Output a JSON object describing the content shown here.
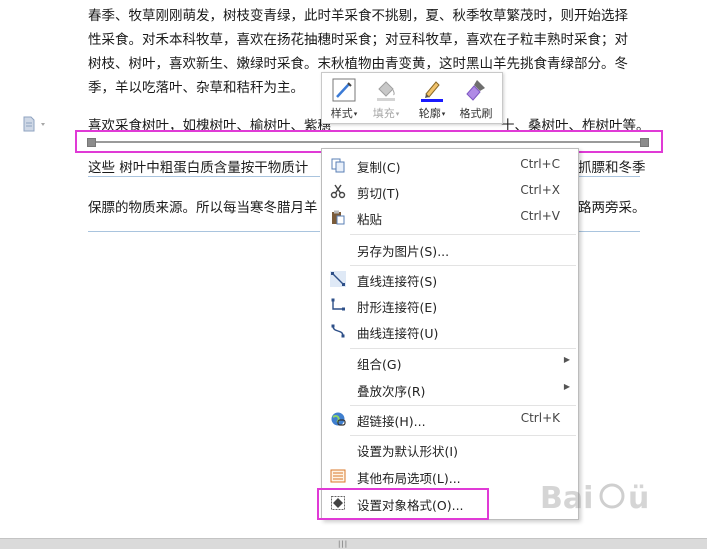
{
  "document": {
    "paragraph1": [
      "春季、牧草刚刚萌发，树枝变青绿，此时羊采食不挑剔，夏、秋季牧草繁茂时，则开始选择",
      "性采食。对禾本科牧草，喜欢在扬花抽穗时采食；对豆科牧草，喜欢在子粒丰熟时采食；对",
      "树枝、树叶，喜欢新生、嫩绿时采食。末秋植物由青变黄，这时黑山羊先挑食青绿部分。冬",
      "季，羊以吃落叶、杂草和秸秆为主。"
    ],
    "line_left": "喜欢采食树叶，如槐树叶、榆树叶、紫穗",
    "line_right": "十、桑树叶、柞树叶等。",
    "line2_left": "这些  树叶中粗蛋白质含量按干物质计",
    "line2_right": "抓膘和冬季",
    "line3_left": "保膘的物质来源。所以每当寒冬腊月羊",
    "line3_right": "路两旁采。"
  },
  "mini_toolbar": {
    "items": [
      {
        "label": "样式",
        "icon": "style-pen-icon",
        "enabled": true,
        "has_dropdown": true
      },
      {
        "label": "填充",
        "icon": "fill-bucket-icon",
        "enabled": false,
        "has_dropdown": true
      },
      {
        "label": "轮廓",
        "icon": "outline-pen-icon",
        "enabled": true,
        "has_dropdown": true
      },
      {
        "label": "格式刷",
        "icon": "format-brush-icon",
        "enabled": true,
        "has_dropdown": false
      }
    ],
    "outline_color": "#1a1aff",
    "brush_color": "#9b6fd6"
  },
  "context_menu": {
    "copy": {
      "label": "复制(C)",
      "shortcut": "Ctrl+C"
    },
    "cut": {
      "label": "剪切(T)",
      "shortcut": "Ctrl+X"
    },
    "paste": {
      "label": "粘贴",
      "shortcut": "Ctrl+V"
    },
    "save_as_image": {
      "label": "另存为图片(S)..."
    },
    "straight_connector": {
      "label": "直线连接符(S)"
    },
    "elbow_connector": {
      "label": "肘形连接符(E)"
    },
    "curve_connector": {
      "label": "曲线连接符(U)"
    },
    "group": {
      "label": "组合(G)"
    },
    "order": {
      "label": "叠放次序(R)"
    },
    "hyperlink": {
      "label": "超链接(H)...",
      "shortcut": "Ctrl+K"
    },
    "set_default_shape": {
      "label": "设置为默认形状(I)"
    },
    "layout_options": {
      "label": "其他布局选项(L)..."
    },
    "format_object": {
      "label": "设置对象格式(O)..."
    }
  },
  "highlight_color": "#e03ad6",
  "statusbar": {
    "grip": "|||"
  }
}
